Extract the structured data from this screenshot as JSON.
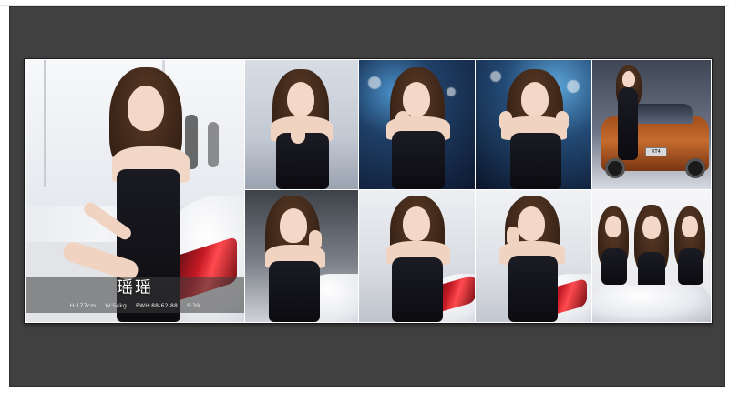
{
  "profile": {
    "name": "瑶瑶",
    "height": "H:177cm",
    "weight": "W:54kg",
    "measurements": "BWH:88-62-88",
    "shoe": "S:39"
  },
  "car_plate": "XT4",
  "colors": {
    "stage_background": "#404040",
    "collage_border": "#1a1a1a",
    "name_band": "rgba(60,60,60,0.55)"
  }
}
